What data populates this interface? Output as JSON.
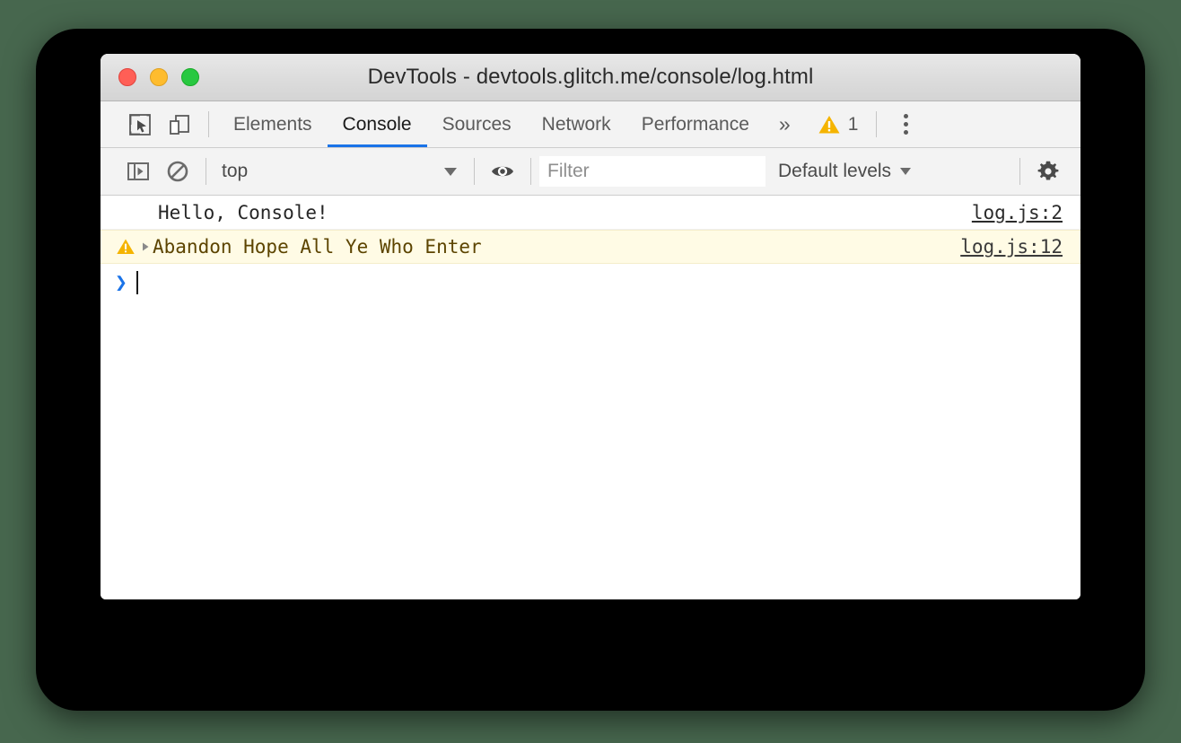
{
  "window": {
    "title": "DevTools - devtools.glitch.me/console/log.html",
    "traffic_lights": [
      {
        "name": "close",
        "color": "#ff5f56"
      },
      {
        "name": "minimize",
        "color": "#febc2e"
      },
      {
        "name": "maximize",
        "color": "#28c840"
      }
    ]
  },
  "tabbar": {
    "icons": [
      {
        "name": "inspect-element-icon",
        "title": "Inspect element"
      },
      {
        "name": "device-toolbar-icon",
        "title": "Toggle device toolbar"
      }
    ],
    "tabs": [
      {
        "label": "Elements",
        "active": false
      },
      {
        "label": "Console",
        "active": true
      },
      {
        "label": "Sources",
        "active": false
      },
      {
        "label": "Network",
        "active": false
      },
      {
        "label": "Performance",
        "active": false
      }
    ],
    "more_tabs_label": "»",
    "warning_count": "1",
    "warning_color": "#f5b400",
    "active_tab_underline_color": "#1a73e8"
  },
  "console_toolbar": {
    "sidebar_toggle_name": "console-sidebar-icon",
    "clear_console_name": "clear-console-icon",
    "context_value": "top",
    "live_expression_name": "eye-icon",
    "filter": {
      "value": "",
      "placeholder": "Filter"
    },
    "levels_label": "Default levels",
    "settings_name": "gear-icon"
  },
  "console_messages": [
    {
      "level": "log",
      "text": "Hello, Console!",
      "source": "log.js:2",
      "expandable": false,
      "icon": ""
    },
    {
      "level": "warning",
      "text": "Abandon Hope All Ye Who Enter",
      "source": "log.js:12",
      "expandable": true,
      "icon": "warning-triangle-icon"
    }
  ],
  "prompt": {
    "chevron": "❯",
    "value": ""
  }
}
